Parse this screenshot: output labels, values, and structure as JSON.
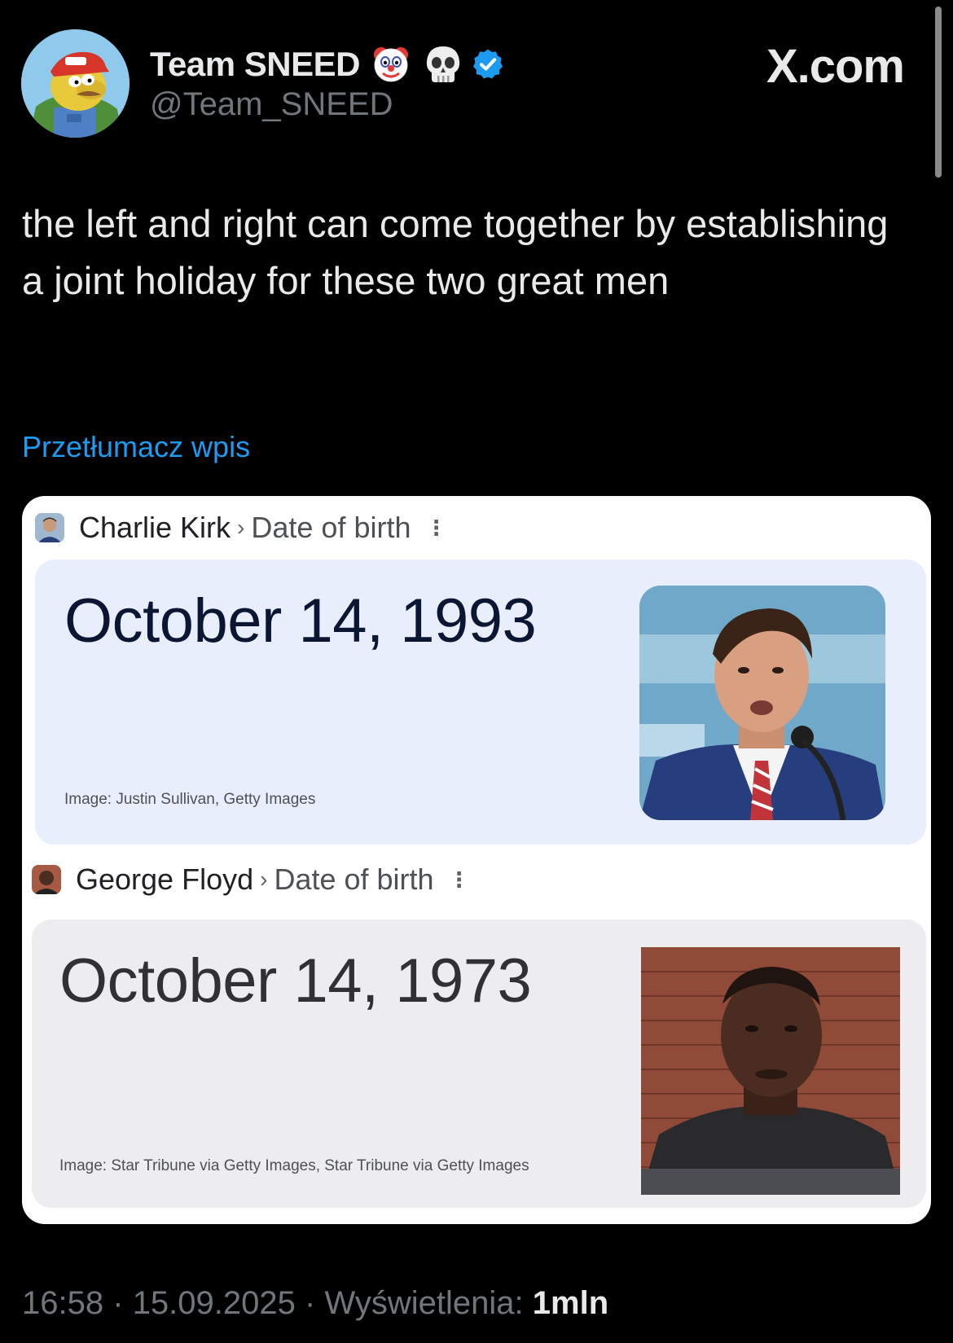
{
  "window": {
    "brand": "X.com"
  },
  "author": {
    "display_name": "Team SNEED",
    "handle": "@Team_SNEED",
    "emojis": [
      "clown-face-icon",
      "skull-icon"
    ],
    "verified_color": "#1d9bf0"
  },
  "post": {
    "text": "the left and right can come together by establishing a joint holiday for these two great men",
    "translate_label": "Przetłumacz wpis"
  },
  "media": {
    "panels": [
      {
        "name": "Charlie Kirk",
        "attribute": "Date of birth",
        "date": "October 14, 1993",
        "credit": "Image: Justin Sullivan, Getty Images",
        "card_color": "#e8eefb"
      },
      {
        "name": "George Floyd",
        "attribute": "Date of birth",
        "date": "October 14, 1973",
        "credit": "Image: Star Tribune via Getty Images, Star Tribune via Getty Images",
        "card_color": "#ededf0"
      }
    ]
  },
  "meta": {
    "time": "16:58",
    "separator": "·",
    "date": "15.09.2025",
    "views_label": "Wyświetlenia:",
    "views_count": "1mln"
  },
  "colors": {
    "background": "#000000",
    "text": "#e7e9ea",
    "secondary": "#71767b",
    "accent": "#1d9bf0"
  }
}
